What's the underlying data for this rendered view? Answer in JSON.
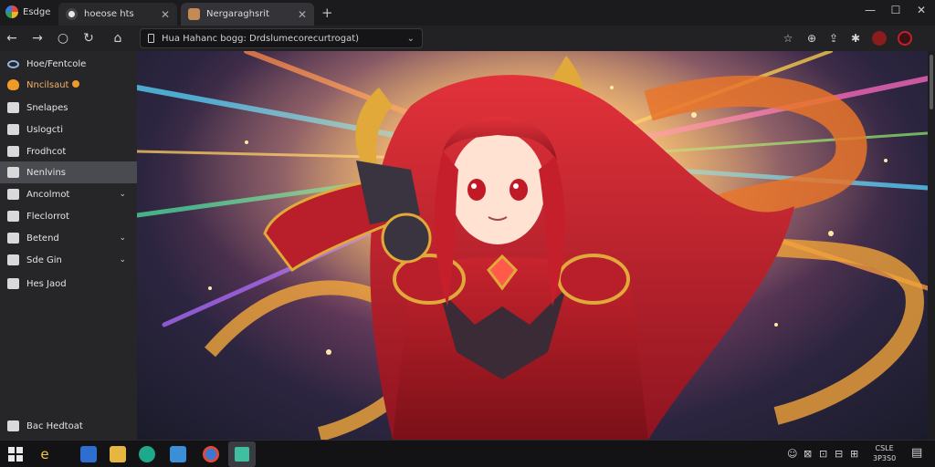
{
  "browser": {
    "app_label": "Esdge",
    "tabs": [
      {
        "title": "hoeose hts",
        "close": "✕"
      },
      {
        "title": "Nergaraghsrit",
        "close": "✕"
      }
    ],
    "new_tab": "+",
    "window_controls": {
      "minimize": "—",
      "maximize": "☐",
      "close": "✕"
    }
  },
  "toolbar": {
    "back": "←",
    "forward": "→",
    "home": "○",
    "refresh": "↻",
    "extension": "⌂",
    "url": "Hua Hahanc bogg: Drdslumecorecurtrogat)",
    "url_chevron": "⌄",
    "right_icons": [
      "☆",
      "⊕",
      "⇪",
      "✱"
    ]
  },
  "sidebar": {
    "items": [
      {
        "label": "Hoe/Fentcole"
      },
      {
        "label": "Nncilsaut"
      },
      {
        "label": "Snelapes"
      },
      {
        "label": "Uslogcti"
      },
      {
        "label": "Frodhcot"
      },
      {
        "label": "Nenlvins"
      },
      {
        "label": "Ancolmot",
        "chevron": "⌄"
      },
      {
        "label": "Fleclorrot"
      },
      {
        "label": "Betend",
        "chevron": "⌄"
      },
      {
        "label": "Sde Gin",
        "chevron": "⌄"
      },
      {
        "label": "Hes Jaod"
      }
    ],
    "footer": {
      "label": "Bac Hedtoat"
    }
  },
  "taskbar": {
    "tray_icons": [
      "☺",
      "⊠",
      "⊡",
      "⊟",
      "⊞"
    ],
    "clock_time": "CSLE",
    "clock_date": "3P3S0"
  },
  "colors": {
    "accent_orange": "#f09a28",
    "active_item": "#4a4b50",
    "avatar_red": "#c21f2a"
  }
}
